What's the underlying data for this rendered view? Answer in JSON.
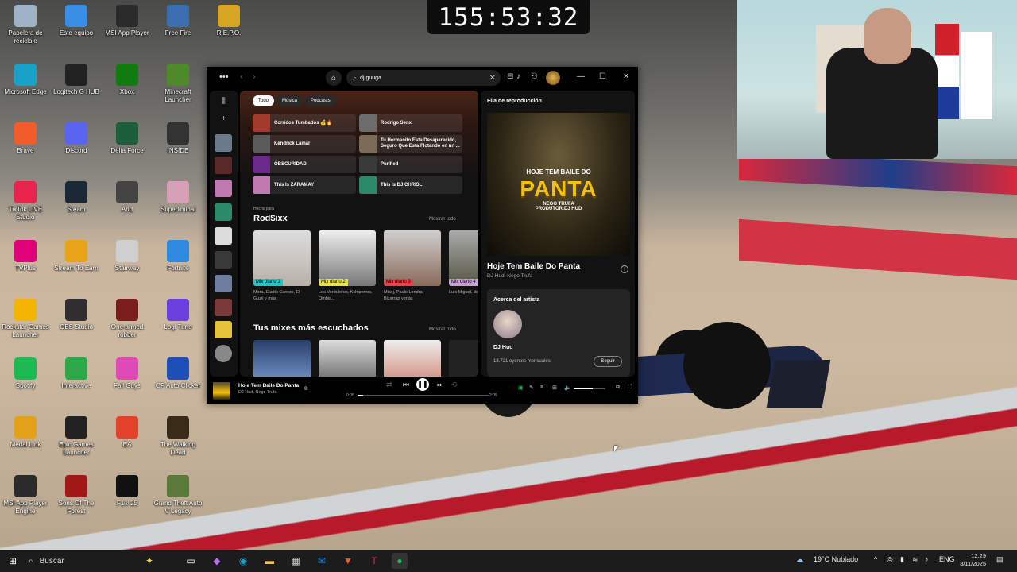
{
  "timer": "155:53:32",
  "desktop_icons": [
    {
      "label": "Papelera de reciclaje",
      "icon": "recycle-bin-icon",
      "color": "#9fb3c8"
    },
    {
      "label": "Este equipo",
      "icon": "computer-icon",
      "color": "#3a8ee6"
    },
    {
      "label": "MSI App Player",
      "icon": "msi-app-player-icon",
      "color": "#2b2b2b"
    },
    {
      "label": "Free Fire",
      "icon": "free-fire-icon",
      "color": "#3c6fb0"
    },
    {
      "label": "R.E.P.O.",
      "icon": "repo-game-icon",
      "color": "#d8a424"
    },
    {
      "label": "Microsoft Edge",
      "icon": "edge-icon",
      "color": "#1aa1c9"
    },
    {
      "label": "Logitech G HUB",
      "icon": "logitech-icon",
      "color": "#222"
    },
    {
      "label": "Xbox",
      "icon": "xbox-icon",
      "color": "#107c10"
    },
    {
      "label": "Minecraft Launcher",
      "icon": "minecraft-icon",
      "color": "#4f8a2a"
    },
    {
      "label": "Brave",
      "icon": "brave-icon",
      "color": "#f25b2a"
    },
    {
      "label": "Discord",
      "icon": "discord-icon",
      "color": "#5865f2"
    },
    {
      "label": "Delta Force",
      "icon": "delta-force-icon",
      "color": "#1b5e3a"
    },
    {
      "label": "INSIDE",
      "icon": "inside-game-icon",
      "color": "#333"
    },
    {
      "label": "TikTok LIVE Studio",
      "icon": "tiktok-icon",
      "color": "#e8234d"
    },
    {
      "label": "Steam",
      "icon": "steam-icon",
      "color": "#1b2838"
    },
    {
      "label": "Arid",
      "icon": "arid-game-icon",
      "color": "#444"
    },
    {
      "label": "Superliminal",
      "icon": "superliminal-icon",
      "color": "#d8a0b8"
    },
    {
      "label": "TVPlus",
      "icon": "tvplus-icon",
      "color": "#e0007a"
    },
    {
      "label": "Stream To Earn",
      "icon": "stream-to-earn-icon",
      "color": "#e8a317"
    },
    {
      "label": "Stairway",
      "icon": "stairway-icon",
      "color": "#cfcfcf"
    },
    {
      "label": "Fortnite",
      "icon": "fortnite-icon",
      "color": "#2f8be0"
    },
    {
      "label": "Rockstar Games Launcher",
      "icon": "rockstar-icon",
      "color": "#f4b400"
    },
    {
      "label": "OBS Studio",
      "icon": "obs-icon",
      "color": "#302e31"
    },
    {
      "label": "One-armed robber",
      "icon": "one-armed-robber-icon",
      "color": "#7a1d1d"
    },
    {
      "label": "Logi Tune",
      "icon": "logi-tune-icon",
      "color": "#6c3fe0"
    },
    {
      "label": "Spotify",
      "icon": "spotify-icon",
      "color": "#1db954"
    },
    {
      "label": "Interactive",
      "icon": "interactive-icon",
      "color": "#2ba84a"
    },
    {
      "label": "Fall Guys",
      "icon": "fall-guys-icon",
      "color": "#e04ab8"
    },
    {
      "label": "OP Auto Clicker",
      "icon": "op-auto-clicker-icon",
      "color": "#1c4fb8"
    },
    {
      "label": "Medal Link",
      "icon": "medal-link-icon",
      "color": "#e3a11a"
    },
    {
      "label": "Epic Games Launcher",
      "icon": "epic-games-icon",
      "color": "#222"
    },
    {
      "label": "EA",
      "icon": "ea-icon",
      "color": "#e3412a"
    },
    {
      "label": "The Walking Dead",
      "icon": "walking-dead-icon",
      "color": "#3a2a1a"
    },
    {
      "label": "MSI App Player Engine",
      "icon": "msi-engine-icon",
      "color": "#2b2b2b"
    },
    {
      "label": "Sons Of The Forest",
      "icon": "sons-forest-icon",
      "color": "#a01818"
    },
    {
      "label": "F1® 25",
      "icon": "f1-icon",
      "color": "#111"
    },
    {
      "label": "Grand Theft Auto V Legacy",
      "icon": "gta-icon",
      "color": "#5a7a3a"
    }
  ],
  "spotify": {
    "search_value": "dj guuga",
    "chips": [
      "Todo",
      "Música",
      "Podcasts"
    ],
    "tiles": [
      {
        "label": "Corridos Tumbados 💰🔥",
        "color": "#a23b2b"
      },
      {
        "label": "Rodrigo Senx",
        "color": "#6c6c6c"
      },
      {
        "label": "Kendrick Lamar",
        "color": "#5a5a5a"
      },
      {
        "label": "Tu Hermanito Esta Desaparecido, Seguro Que Esta Flotando en un ...",
        "color": "#7d6b5a"
      },
      {
        "label": "OBSCURIDAD",
        "color": "#6a2a8a"
      },
      {
        "label": "Purified",
        "color": "#3a3a3a"
      },
      {
        "label": "This Is ZARAMAY",
        "color": "#c07ab0"
      },
      {
        "label": "This Is DJ CHRISL",
        "color": "#2a8a6a"
      }
    ],
    "made_for_small": "Hecho para",
    "made_for_title": "Rod$ixx",
    "show_all": "Mostrar todo",
    "mixes": [
      {
        "label": "Mix diario 1",
        "desc": "Mora, Eladio Carrion, El Guzii y más",
        "color": "#22c3c5"
      },
      {
        "label": "Mix diario 2",
        "desc": "Los Verduleros, Kchiporros, Qmbia...",
        "color": "#e6e34a"
      },
      {
        "label": "Mix diario 3",
        "desc": "Milo j, Paulo Londra, Bizarrap y más",
        "color": "#e8414a"
      },
      {
        "label": "Mix diario 4",
        "desc": "Luis Miguel, de Van Gogh",
        "color": "#c7a0d4"
      }
    ],
    "top_mixes_title": "Tus mixes más escuchados",
    "queue_title": "Fila de reproducción",
    "cover_line1": "HOJE TEM BAILE DO",
    "cover_line2": "PANTA",
    "cover_line3": "NEGO TRUFA\nPRODUTOR:DJ HUD",
    "track_title": "Hoje Tem Baile Do Panta",
    "track_artists": "DJ Hud, Nego Trufa",
    "about_title": "Acerca del artista",
    "artist_name": "DJ Hud",
    "listeners": "13.721 oyentes mensuales",
    "follow": "Seguir",
    "player": {
      "title": "Hoje Tem Baile Do Panta",
      "artists": "DJ Hud, Nego Trufa",
      "elapsed": "0:05",
      "duration": "2:05",
      "progress": 0.04,
      "volume": 0.6
    }
  },
  "taskbar": {
    "search_placeholder": "Buscar",
    "weather": "19°C Nublado",
    "lang": "ENG",
    "time": "12:29",
    "date": "8/11/2025"
  }
}
